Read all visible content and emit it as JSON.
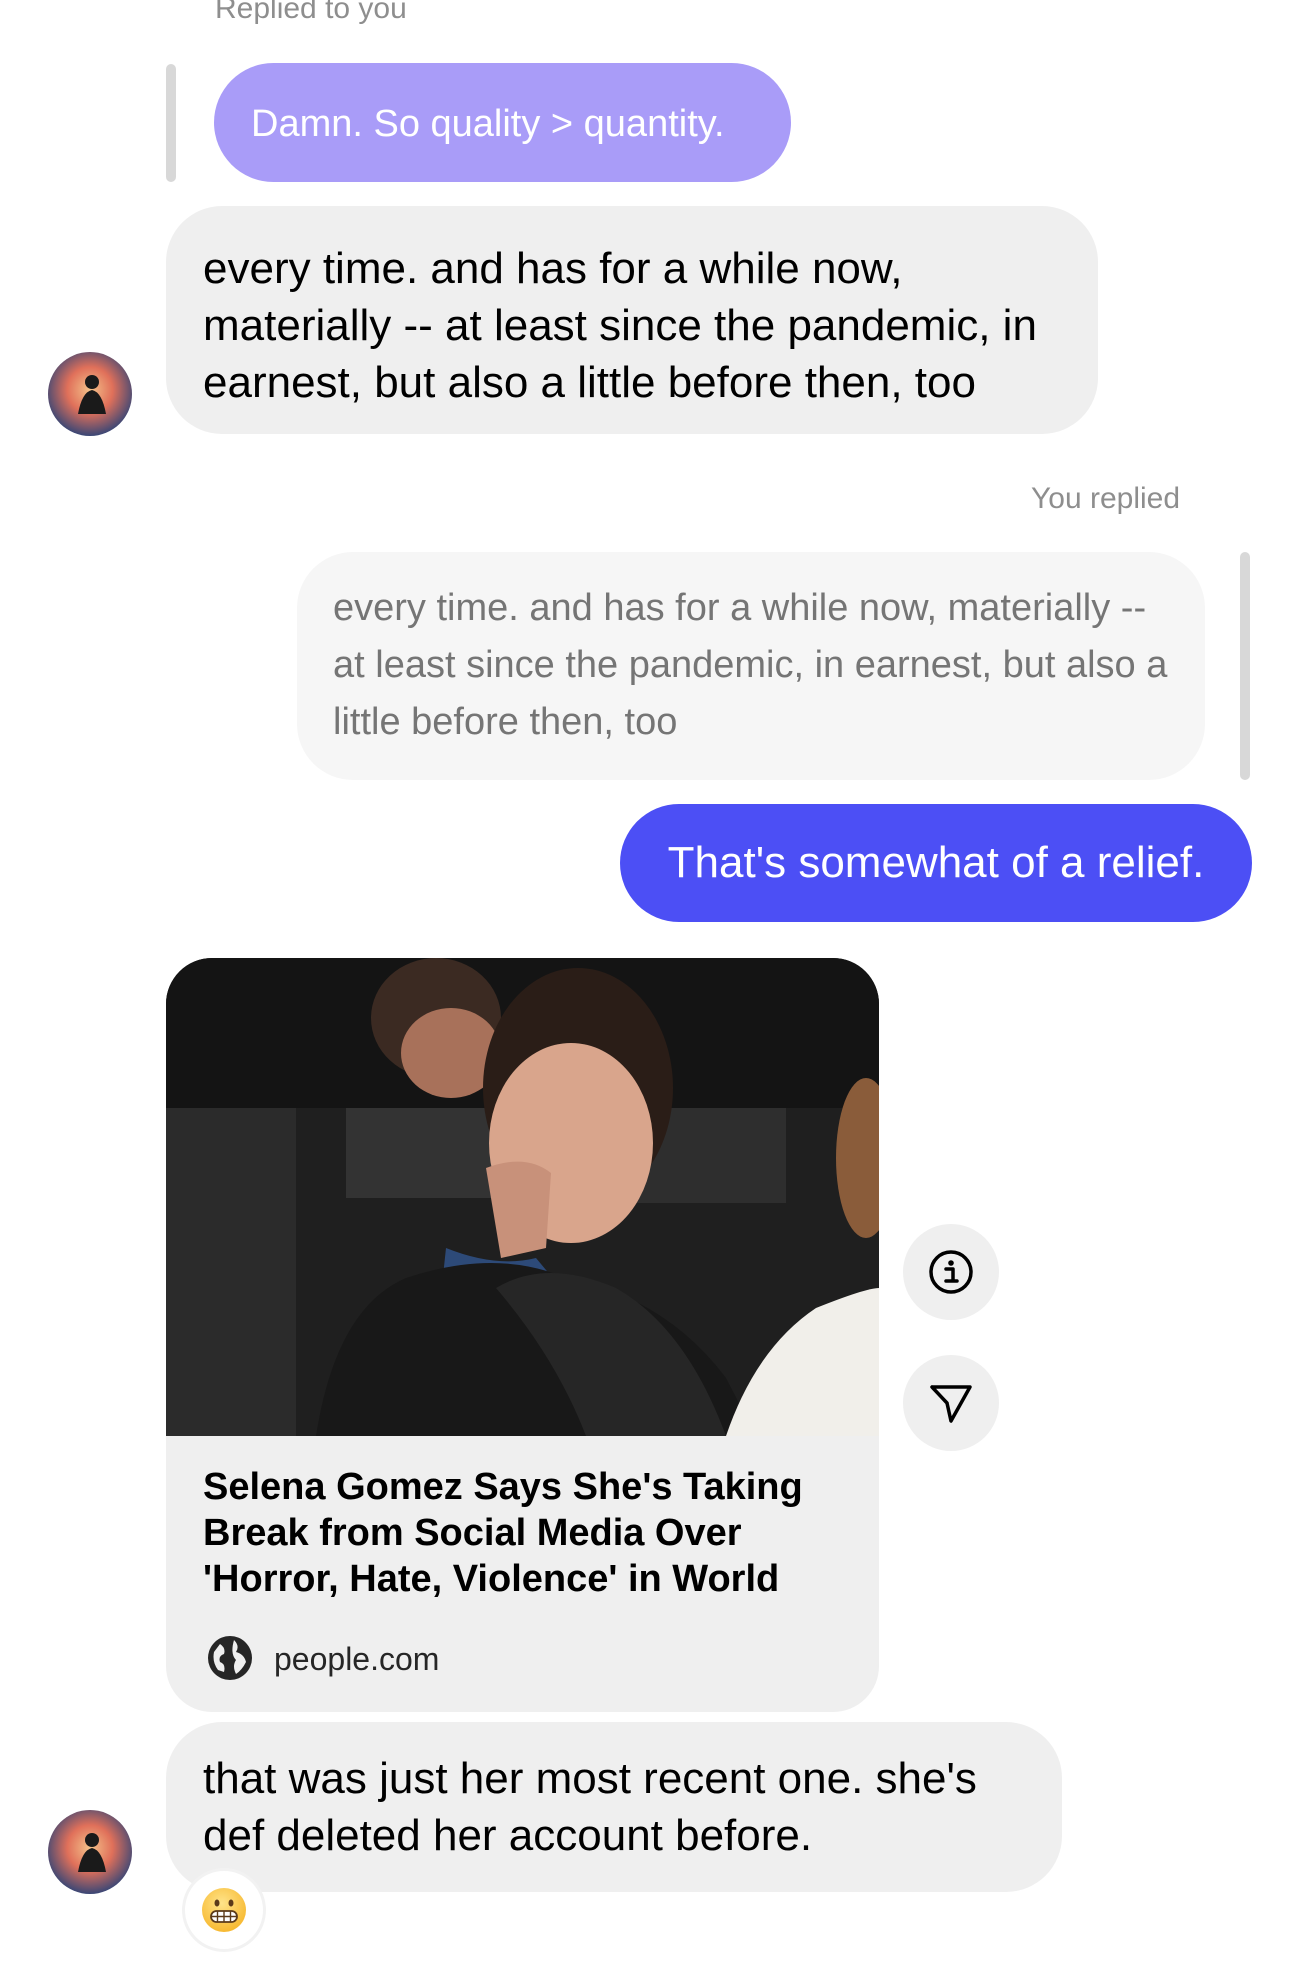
{
  "thread": {
    "reply_to_you": {
      "caption": "Replied to you",
      "quoted_text": "Damn. So quality > quantity.",
      "message": "every time. and has for a while now, materially -- at least since the pandemic, in earnest, but also a little before then, too"
    },
    "you_replied": {
      "caption": "You replied",
      "quoted_text": "every time. and has for a while now, materially -- at least since the pandemic, in earnest, but also a little before then, too",
      "message": "That's somewhat of a relief."
    },
    "shared_link": {
      "title": "Selena Gomez Says She's Taking Break from Social Media Over 'Horror, Hate, Violence' in World",
      "source": "people.com",
      "info_icon": "info-icon",
      "share_icon": "send-icon",
      "globe_icon": "globe-icon"
    },
    "last_message": {
      "text": "that was just her most recent one. she's def deleted her account before.",
      "reaction_icon": "grimacing-face-emoji"
    }
  },
  "colors": {
    "outgoing_bubble": "#4c4ff5",
    "quoted_outgoing": "#a99cf8",
    "incoming_bubble": "#efefef",
    "caption_text": "#8e8e8e"
  }
}
